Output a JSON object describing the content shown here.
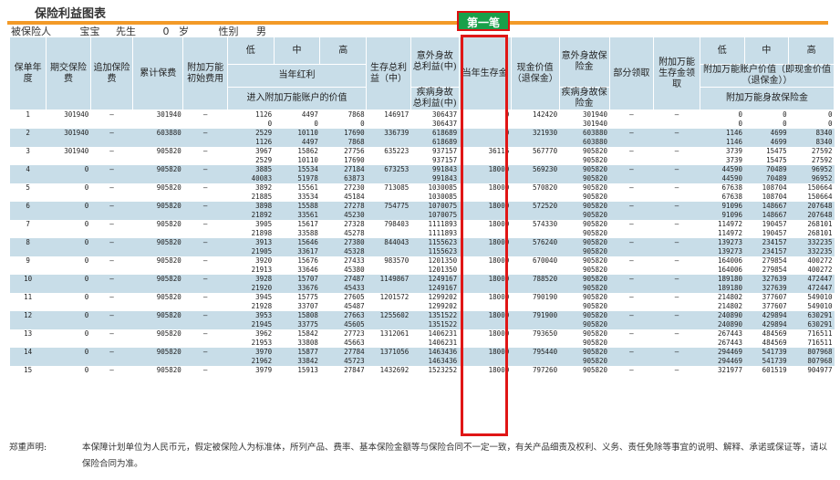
{
  "title": "保险利益图表",
  "tag": "第一笔",
  "insured": {
    "label": "被保险人",
    "name": "宝宝",
    "title": "先生",
    "age": "0",
    "age_unit": "岁",
    "sex_label": "性别",
    "sex": "男"
  },
  "headers": {
    "year": "保单年度",
    "premium": "期交保险费",
    "extra_premium": "追加保险费",
    "cum_premium": "累计保费",
    "addon_initial": "附加万能初始费用",
    "low": "低",
    "mid": "中",
    "high": "高",
    "bonus": "当年红利",
    "into_account": "进入附加万能账户的价值",
    "survival_total": "生存总利益（中）",
    "accident_total": "意外身故总利益(中)",
    "disease_total": "疾病身故总利益(中)",
    "annual_survival": "当年生存金",
    "cash_value": "现金价值（退保金）",
    "accident_benefit": "意外身故保险金",
    "disease_benefit": "疾病身故保险金",
    "partial_withdraw": "部分领取",
    "addon_survival": "附加万能生存金领取",
    "account_value": "附加万能账户价值（即现金价值（退保金））",
    "addon_death": "附加万能身故保险金"
  },
  "rows": [
    {
      "year": "1",
      "premium": "301940",
      "extra": "—",
      "cum": "301940",
      "fee": "—",
      "low": [
        "1126",
        "0"
      ],
      "mid": [
        "4497",
        "0"
      ],
      "high": [
        "7868",
        "0"
      ],
      "survival": "146917",
      "acc_dis": [
        "306437",
        "306437"
      ],
      "annual": "0",
      "cash": "142420",
      "benefit": [
        "301940",
        "301940"
      ],
      "partial": "—",
      "addon": "—",
      "al": [
        "0",
        "0"
      ],
      "am": [
        "0",
        "0"
      ],
      "ah": [
        "0",
        "0"
      ]
    },
    {
      "year": "2",
      "premium": "301940",
      "extra": "—",
      "cum": "603880",
      "fee": "—",
      "low": [
        "2529",
        "1126"
      ],
      "mid": [
        "10110",
        "4497"
      ],
      "high": [
        "17690",
        "7868"
      ],
      "survival": "336739",
      "acc_dis": [
        "618689",
        "618689"
      ],
      "annual": "0",
      "cash": "321930",
      "benefit": [
        "603880",
        "603880"
      ],
      "partial": "—",
      "addon": "—",
      "al": [
        "1146",
        "1146"
      ],
      "am": [
        "4699",
        "4699"
      ],
      "ah": [
        "8340",
        "8340"
      ]
    },
    {
      "year": "3",
      "premium": "301940",
      "extra": "—",
      "cum": "905820",
      "fee": "—",
      "low": [
        "3967",
        "2529"
      ],
      "mid": [
        "15862",
        "10110"
      ],
      "high": [
        "27756",
        "17690"
      ],
      "survival": "635223",
      "acc_dis": [
        "937157",
        "937157"
      ],
      "annual": "36116",
      "cash": "567770",
      "benefit": [
        "905820",
        "905820"
      ],
      "partial": "—",
      "addon": "—",
      "al": [
        "3739",
        "3739"
      ],
      "am": [
        "15475",
        "15475"
      ],
      "ah": [
        "27592",
        "27592"
      ]
    },
    {
      "year": "4",
      "premium": "0",
      "extra": "—",
      "cum": "905820",
      "fee": "—",
      "low": [
        "3885",
        "40083"
      ],
      "mid": [
        "15534",
        "51978"
      ],
      "high": [
        "27184",
        "63873"
      ],
      "survival": "673253",
      "acc_dis": [
        "991843",
        "991843"
      ],
      "annual": "18000",
      "cash": "569230",
      "benefit": [
        "905820",
        "905820"
      ],
      "partial": "—",
      "addon": "—",
      "al": [
        "44590",
        "44590"
      ],
      "am": [
        "70489",
        "70489"
      ],
      "ah": [
        "96952",
        "96952"
      ]
    },
    {
      "year": "5",
      "premium": "0",
      "extra": "—",
      "cum": "905820",
      "fee": "—",
      "low": [
        "3892",
        "21885"
      ],
      "mid": [
        "15561",
        "33534"
      ],
      "high": [
        "27230",
        "45184"
      ],
      "survival": "713085",
      "acc_dis": [
        "1030085",
        "1030085"
      ],
      "annual": "18000",
      "cash": "570820",
      "benefit": [
        "905820",
        "905820"
      ],
      "partial": "—",
      "addon": "—",
      "al": [
        "67638",
        "67638"
      ],
      "am": [
        "108704",
        "108704"
      ],
      "ah": [
        "150664",
        "150664"
      ]
    },
    {
      "year": "6",
      "premium": "0",
      "extra": "—",
      "cum": "905820",
      "fee": "—",
      "low": [
        "3898",
        "21892"
      ],
      "mid": [
        "15588",
        "33561"
      ],
      "high": [
        "27278",
        "45230"
      ],
      "survival": "754775",
      "acc_dis": [
        "1070075",
        "1070075"
      ],
      "annual": "18000",
      "cash": "572520",
      "benefit": [
        "905820",
        "905820"
      ],
      "partial": "—",
      "addon": "—",
      "al": [
        "91096",
        "91096"
      ],
      "am": [
        "148667",
        "148667"
      ],
      "ah": [
        "207648",
        "207648"
      ]
    },
    {
      "year": "7",
      "premium": "0",
      "extra": "—",
      "cum": "905820",
      "fee": "—",
      "low": [
        "3905",
        "21898"
      ],
      "mid": [
        "15617",
        "33588"
      ],
      "high": [
        "27328",
        "45278"
      ],
      "survival": "798403",
      "acc_dis": [
        "1111893",
        "1111893"
      ],
      "annual": "18000",
      "cash": "574330",
      "benefit": [
        "905820",
        "905820"
      ],
      "partial": "—",
      "addon": "—",
      "al": [
        "114972",
        "114972"
      ],
      "am": [
        "190457",
        "190457"
      ],
      "ah": [
        "268101",
        "268101"
      ]
    },
    {
      "year": "8",
      "premium": "0",
      "extra": "—",
      "cum": "905820",
      "fee": "—",
      "low": [
        "3913",
        "21905"
      ],
      "mid": [
        "15646",
        "33617"
      ],
      "high": [
        "27380",
        "45328"
      ],
      "survival": "844043",
      "acc_dis": [
        "1155623",
        "1155623"
      ],
      "annual": "18000",
      "cash": "576240",
      "benefit": [
        "905820",
        "905820"
      ],
      "partial": "—",
      "addon": "—",
      "al": [
        "139273",
        "139273"
      ],
      "am": [
        "234157",
        "234157"
      ],
      "ah": [
        "332235",
        "332235"
      ]
    },
    {
      "year": "9",
      "premium": "0",
      "extra": "—",
      "cum": "905820",
      "fee": "—",
      "low": [
        "3920",
        "21913"
      ],
      "mid": [
        "15676",
        "33646"
      ],
      "high": [
        "27433",
        "45380"
      ],
      "survival": "983570",
      "acc_dis": [
        "1201350",
        "1201350"
      ],
      "annual": "18000",
      "cash": "670040",
      "benefit": [
        "905820",
        "905820"
      ],
      "partial": "—",
      "addon": "—",
      "al": [
        "164006",
        "164006"
      ],
      "am": [
        "279854",
        "279854"
      ],
      "ah": [
        "400272",
        "400272"
      ]
    },
    {
      "year": "10",
      "premium": "0",
      "extra": "—",
      "cum": "905820",
      "fee": "—",
      "low": [
        "3928",
        "21920"
      ],
      "mid": [
        "15707",
        "33676"
      ],
      "high": [
        "27487",
        "45433"
      ],
      "survival": "1149867",
      "acc_dis": [
        "1249167",
        "1249167"
      ],
      "annual": "18000",
      "cash": "788520",
      "benefit": [
        "905820",
        "905820"
      ],
      "partial": "—",
      "addon": "—",
      "al": [
        "189180",
        "189180"
      ],
      "am": [
        "327639",
        "327639"
      ],
      "ah": [
        "472447",
        "472447"
      ]
    },
    {
      "year": "11",
      "premium": "0",
      "extra": "—",
      "cum": "905820",
      "fee": "—",
      "low": [
        "3945",
        "21928"
      ],
      "mid": [
        "15775",
        "33707"
      ],
      "high": [
        "27605",
        "45487"
      ],
      "survival": "1201572",
      "acc_dis": [
        "1299202",
        "1299202"
      ],
      "annual": "18000",
      "cash": "790190",
      "benefit": [
        "905820",
        "905820"
      ],
      "partial": "—",
      "addon": "—",
      "al": [
        "214802",
        "214802"
      ],
      "am": [
        "377607",
        "377607"
      ],
      "ah": [
        "549010",
        "549010"
      ]
    },
    {
      "year": "12",
      "premium": "0",
      "extra": "—",
      "cum": "905820",
      "fee": "—",
      "low": [
        "3953",
        "21945"
      ],
      "mid": [
        "15808",
        "33775"
      ],
      "high": [
        "27663",
        "45605"
      ],
      "survival": "1255602",
      "acc_dis": [
        "1351522",
        "1351522"
      ],
      "annual": "18000",
      "cash": "791900",
      "benefit": [
        "905820",
        "905820"
      ],
      "partial": "—",
      "addon": "—",
      "al": [
        "240890",
        "240890"
      ],
      "am": [
        "429894",
        "429894"
      ],
      "ah": [
        "630291",
        "630291"
      ]
    },
    {
      "year": "13",
      "premium": "0",
      "extra": "—",
      "cum": "905820",
      "fee": "—",
      "low": [
        "3962",
        "21953"
      ],
      "mid": [
        "15842",
        "33808"
      ],
      "high": [
        "27723",
        "45663"
      ],
      "survival": "1312061",
      "acc_dis": [
        "1406231",
        "1406231"
      ],
      "annual": "18000",
      "cash": "793650",
      "benefit": [
        "905820",
        "905820"
      ],
      "partial": "—",
      "addon": "—",
      "al": [
        "267443",
        "267443"
      ],
      "am": [
        "484569",
        "484569"
      ],
      "ah": [
        "716511",
        "716511"
      ]
    },
    {
      "year": "14",
      "premium": "0",
      "extra": "—",
      "cum": "905820",
      "fee": "—",
      "low": [
        "3970",
        "21962"
      ],
      "mid": [
        "15877",
        "33842"
      ],
      "high": [
        "27784",
        "45723"
      ],
      "survival": "1371056",
      "acc_dis": [
        "1463436",
        "1463436"
      ],
      "annual": "18000",
      "cash": "795440",
      "benefit": [
        "905820",
        "905820"
      ],
      "partial": "—",
      "addon": "—",
      "al": [
        "294469",
        "294469"
      ],
      "am": [
        "541739",
        "541739"
      ],
      "ah": [
        "807968",
        "807968"
      ]
    },
    {
      "year": "15",
      "premium": "0",
      "extra": "—",
      "cum": "905820",
      "fee": "—",
      "low": [
        "3979"
      ],
      "mid": [
        "15913"
      ],
      "high": [
        "27847"
      ],
      "survival": "1432692",
      "acc_dis": [
        "1523252"
      ],
      "annual": "18000",
      "cash": "797260",
      "benefit": [
        "905820"
      ],
      "partial": "—",
      "addon": "—",
      "al": [
        "321977"
      ],
      "am": [
        "601519"
      ],
      "ah": [
        "904977"
      ]
    }
  ],
  "footer": {
    "label": "郑重声明:",
    "text": "本保障计划单位为人民币元，假定被保险人为标准体，所列产品、费率、基本保险金额等与保险合同不一定一致，有关产品细责及权利、义务、责任免除等事宜的说明、解释、承诺或保证等，请以保险合同为准。"
  },
  "colors": {
    "header_bg": "#c8dde8",
    "accent": "#f39a28",
    "highlight": "#e01616",
    "tag_bg": "#19a04a"
  }
}
